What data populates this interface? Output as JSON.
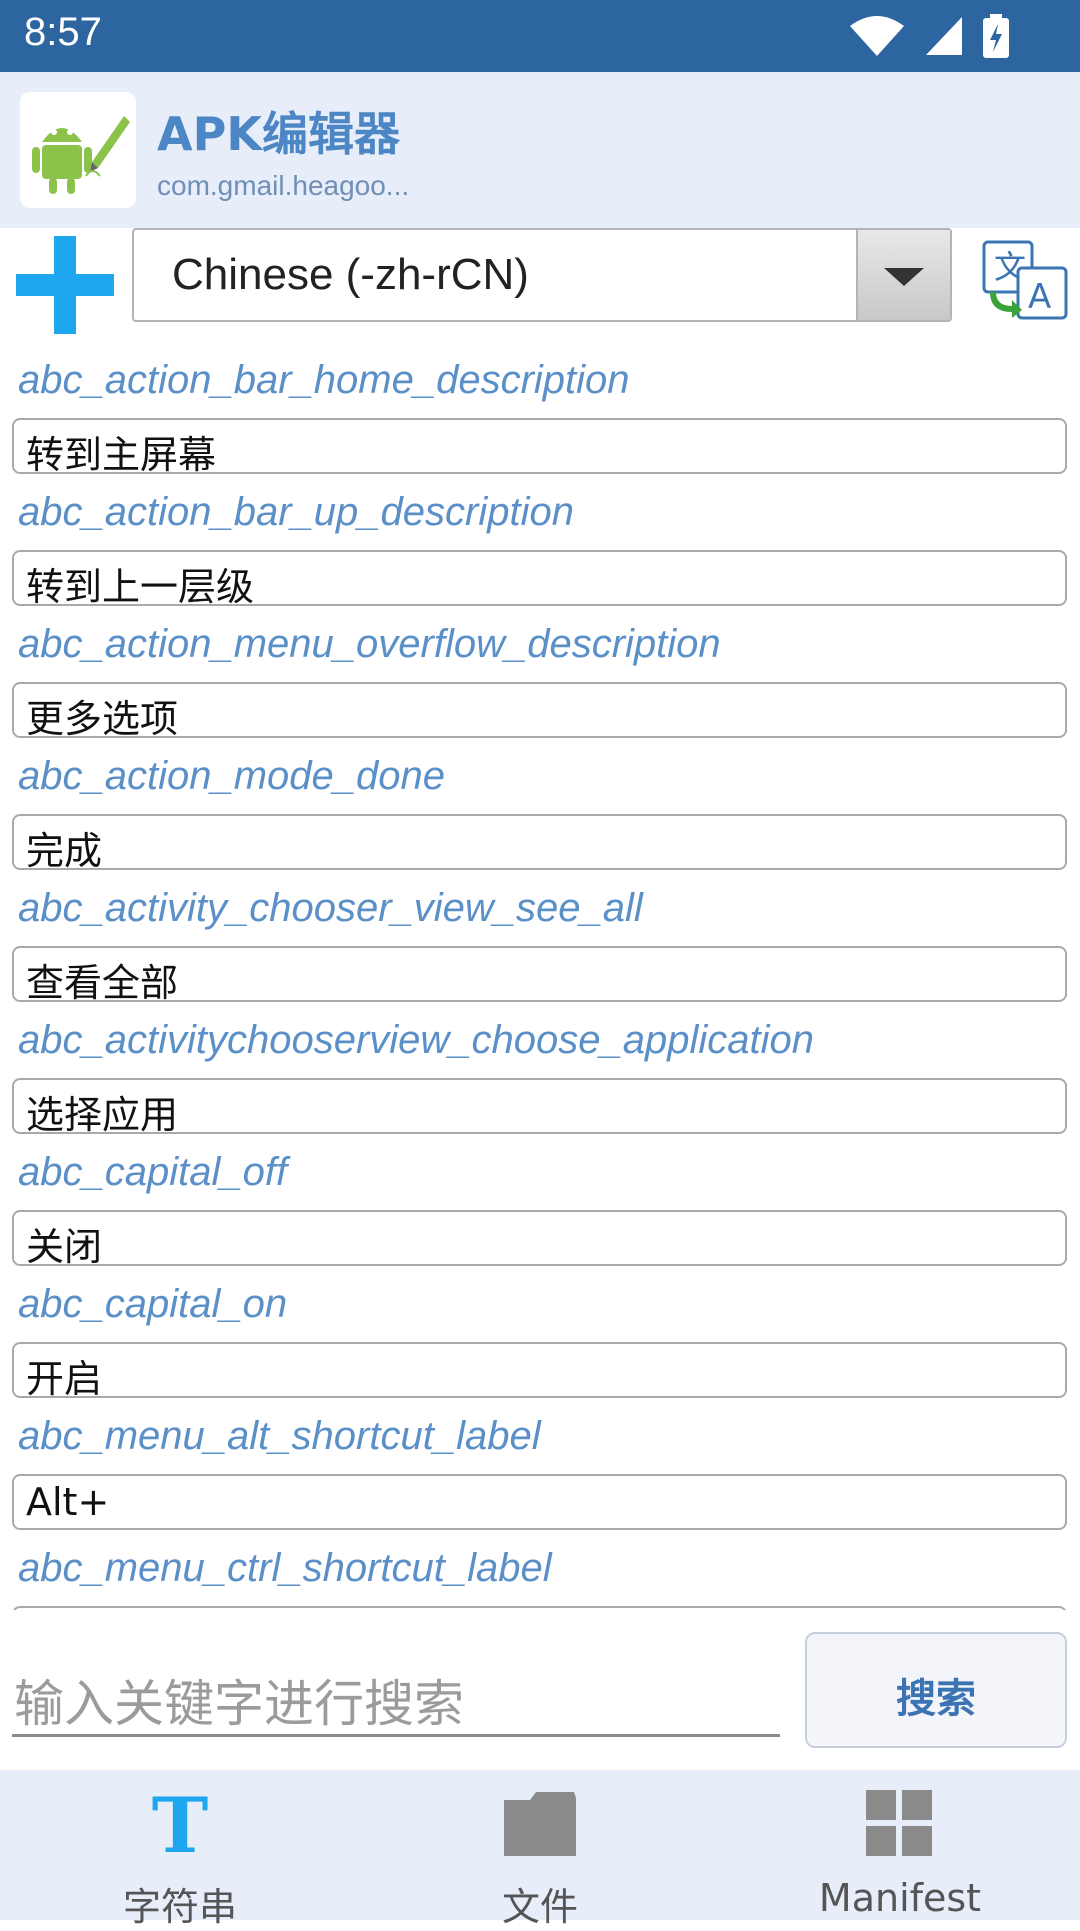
{
  "status": {
    "time": "8:57"
  },
  "app": {
    "name": "APK编辑器",
    "package": "com.gmail.heagoo..."
  },
  "toolbar": {
    "language": "Chinese (-zh-rCN)"
  },
  "strings": [
    {
      "key": "abc_action_bar_home_description",
      "value": "转到主屏幕"
    },
    {
      "key": "abc_action_bar_up_description",
      "value": "转到上一层级"
    },
    {
      "key": "abc_action_menu_overflow_description",
      "value": "更多选项"
    },
    {
      "key": "abc_action_mode_done",
      "value": "完成"
    },
    {
      "key": "abc_activity_chooser_view_see_all",
      "value": "查看全部"
    },
    {
      "key": "abc_activitychooserview_choose_application",
      "value": "选择应用"
    },
    {
      "key": "abc_capital_off",
      "value": "关闭"
    },
    {
      "key": "abc_capital_on",
      "value": "开启"
    },
    {
      "key": "abc_menu_alt_shortcut_label",
      "value": "Alt+"
    },
    {
      "key": "abc_menu_ctrl_shortcut_label",
      "value": ""
    }
  ],
  "search": {
    "placeholder": "输入关键字进行搜索",
    "button": "搜索"
  },
  "nav": [
    {
      "label": "字符串",
      "icon": "text-icon"
    },
    {
      "label": "文件",
      "icon": "folder-icon"
    },
    {
      "label": "Manifest",
      "icon": "grid-icon"
    }
  ],
  "colors": {
    "statusbar": "#2c65a0",
    "accent": "#1ea6ee",
    "key_text": "#5a8fc8",
    "header_bg": "#e7eef9"
  }
}
